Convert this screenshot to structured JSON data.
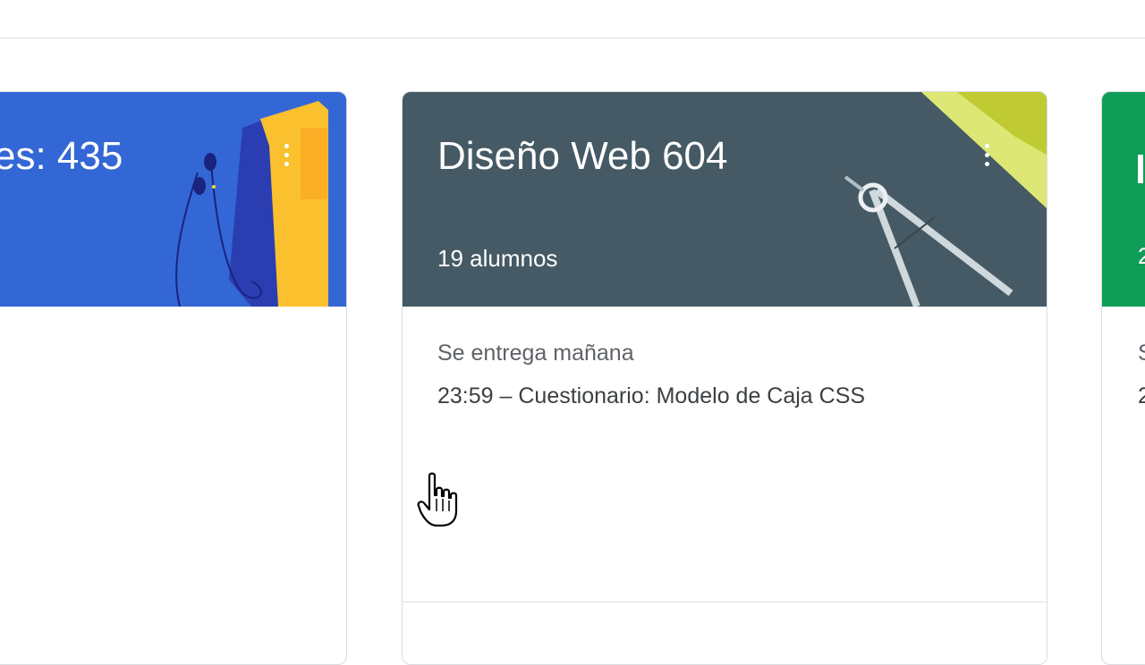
{
  "cards": [
    {
      "title": "es: 435",
      "color": "#3367d6",
      "art": "headphones-and-notebook"
    },
    {
      "title": "Diseño Web 604",
      "subtitle": "19 alumnos",
      "color": "#455a64",
      "art": "compass-and-ruler",
      "due_label": "Se entrega mañana",
      "assignment": "23:59 – Cuestionario: Modelo de Caja CSS"
    },
    {
      "title": "",
      "color": "#0f9d58",
      "subtitle_partial": "2",
      "due_partial": "S",
      "assignment_partial": "2"
    }
  ],
  "icons": {
    "more": "more-vert-icon",
    "cursor": "hand-pointer-icon"
  }
}
